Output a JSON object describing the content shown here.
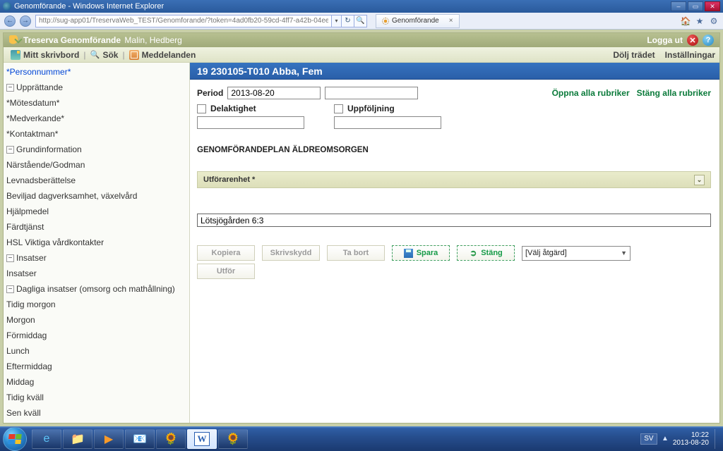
{
  "window": {
    "title": "Genomförande - Windows Internet Explorer"
  },
  "browser": {
    "url": "http://sug-app01/TreservaWeb_TEST/Genomforande/?token=4ad0fb20-59cd-4ff7-a42b-04ee71bcece1",
    "tab_label": "Genomförande"
  },
  "app": {
    "brand": "Treserva Genomförande",
    "user": "Malin, Hedberg",
    "logout": "Logga ut",
    "toolbar": {
      "desktop": "Mitt skrivbord",
      "search": "Sök",
      "messages": "Meddelanden",
      "hide_tree": "Dölj trädet",
      "settings": "Inställningar"
    }
  },
  "tree": {
    "personnummer": "*Personnummer*",
    "upprattande": {
      "label": "Upprättande",
      "children": [
        "*Mötesdatum*",
        "*Medverkande*",
        "*Kontaktman*"
      ]
    },
    "grundinfo": {
      "label": "Grundinformation",
      "children": [
        "Närstående/Godman",
        "Levnadsberättelse",
        "Beviljad dagverksamhet, växelvård",
        "Hjälpmedel",
        "Färdtjänst",
        "HSL Viktiga vårdkontakter"
      ]
    },
    "insatser": {
      "label": "Insatser",
      "children": [
        "Insatser"
      ]
    },
    "dagliga": {
      "label": "Dagliga insatser (omsorg och mathållning)",
      "children": [
        "Tidig morgon",
        "Morgon",
        "Förmiddag",
        "Lunch",
        "Eftermiddag",
        "Middag",
        "Tidig kväll",
        "Sen kväll"
      ]
    }
  },
  "main": {
    "patient": "19 230105-T010 Abba, Fem",
    "period_label": "Period",
    "period_from": "2013-08-20",
    "period_to": "",
    "open_all": "Öppna alla rubriker",
    "close_all": "Stäng alla rubriker",
    "delaktighet": "Delaktighet",
    "uppfoljning": "Uppföljning",
    "section_title": "GENOMFÖRANDEPLAN ÄLDREOMSORGEN",
    "accordion": "Utförarenhet *",
    "unit_value": "Lötsjögården 6:3",
    "buttons": {
      "kopiera": "Kopiera",
      "skrivskydd": "Skrivskydd",
      "tabort": "Ta bort",
      "spara": "Spara",
      "stang": "Stäng",
      "utfor": "Utför",
      "select": "[Välj åtgärd]"
    }
  },
  "taskbar": {
    "lang": "SV",
    "time": "10:22",
    "date": "2013-08-20"
  }
}
